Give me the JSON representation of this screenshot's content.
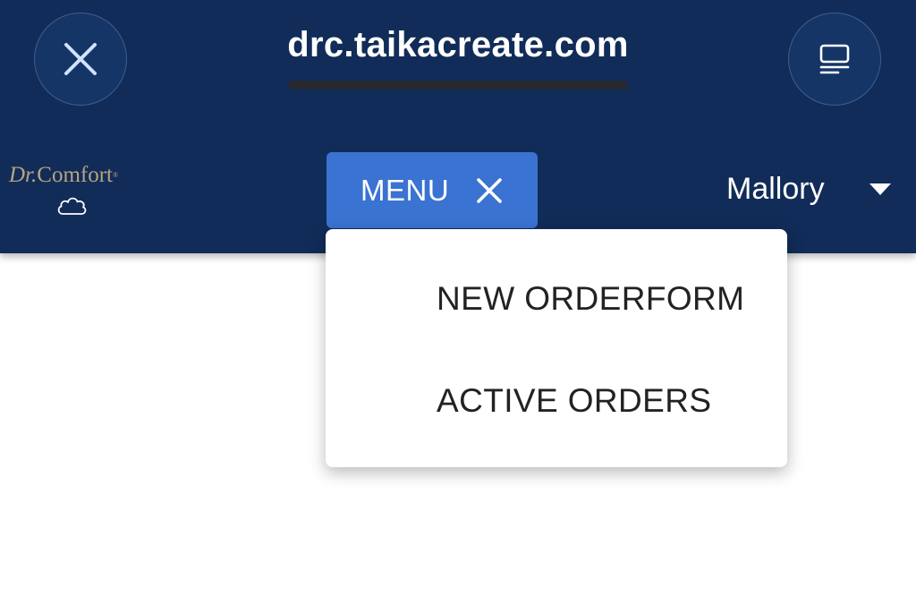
{
  "browser": {
    "url": "drc.taikacreate.com",
    "loading_progress": 1.0
  },
  "logo": {
    "dr": "Dr.",
    "comfort": "Comfort",
    "registered": "®",
    "icon": "cloud-icon"
  },
  "menu": {
    "label": "MENU",
    "close_icon": "close-icon",
    "items": [
      {
        "label": "NEW ORDERFORM"
      },
      {
        "label": "ACTIVE ORDERS"
      }
    ]
  },
  "user": {
    "name": "Mallory",
    "dropdown_icon": "caret-down-icon"
  },
  "colors": {
    "header_bg": "#112c58",
    "menu_button": "#3a73d1",
    "logo_gold": "#b6a483",
    "dropdown_text": "#222222"
  }
}
